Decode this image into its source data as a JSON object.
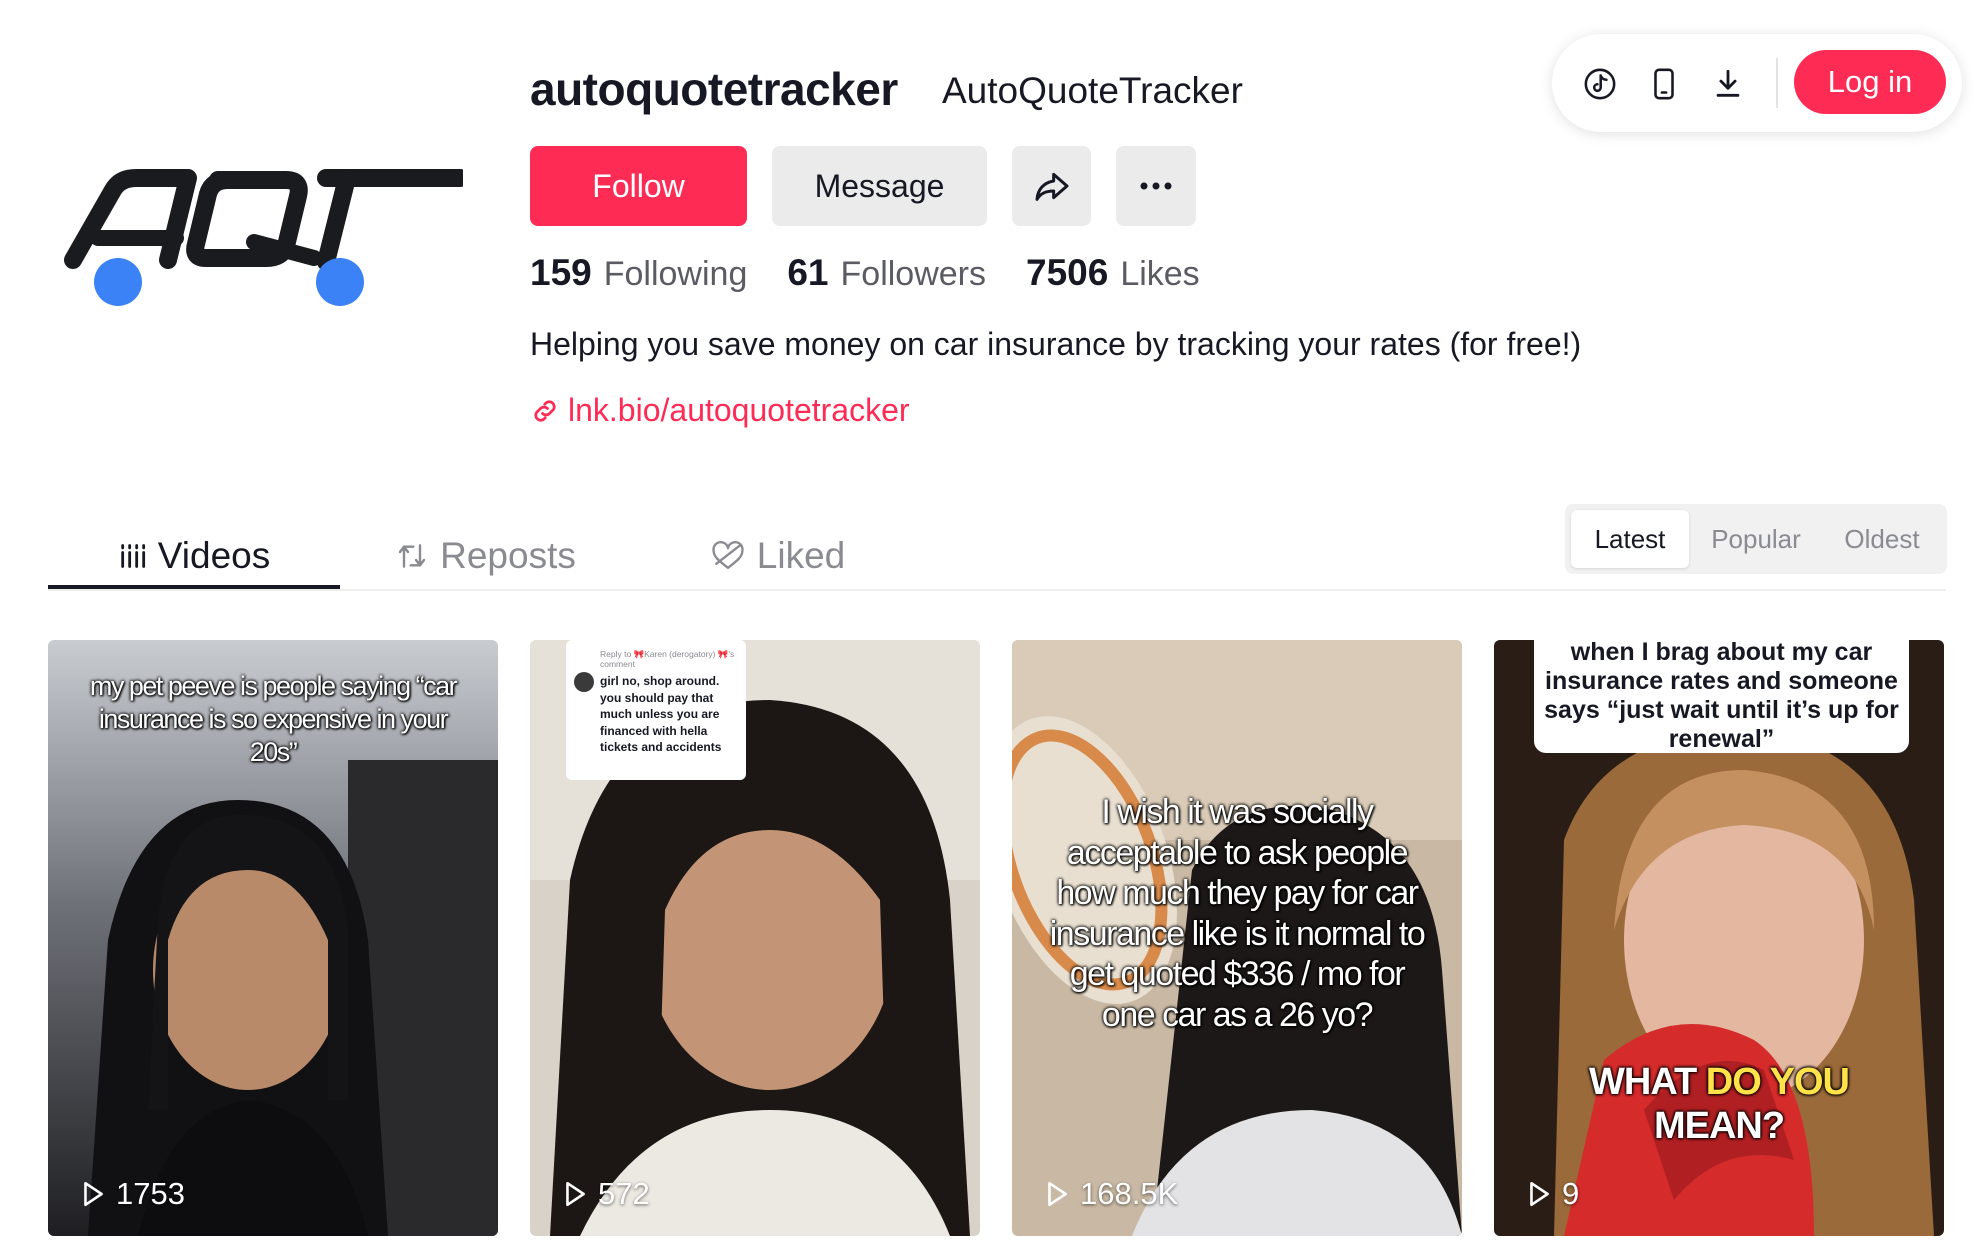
{
  "profile": {
    "username": "autoquotetracker",
    "nickname": "AutoQuoteTracker",
    "follow_label": "Follow",
    "message_label": "Message",
    "bio": "Helping you save money on car insurance by tracking your rates (for free!)",
    "link": "lnk.bio/autoquotetracker",
    "avatar_text": "AQT",
    "stats": [
      {
        "value": "159",
        "label": "Following"
      },
      {
        "value": "61",
        "label": "Followers"
      },
      {
        "value": "7506",
        "label": "Likes"
      }
    ],
    "icons": {
      "share": "share-icon",
      "more": "more-icon",
      "link": "link-icon"
    }
  },
  "topbar": {
    "login_label": "Log in",
    "icons": [
      "tiktok-icon",
      "mobile-icon",
      "download-icon"
    ]
  },
  "tabs": [
    {
      "label": "Videos",
      "icon": "grid-icon"
    },
    {
      "label": "Reposts",
      "icon": "repost-icon"
    },
    {
      "label": "Liked",
      "icon": "liked-heart-icon"
    }
  ],
  "sort": [
    "Latest",
    "Popular",
    "Oldest"
  ],
  "videos": [
    {
      "caption": "my pet peeve is people saying “car insurance is so expensive in your 20s”",
      "views": "1753"
    },
    {
      "caption": "I wish it was socially acceptable to ask people how much they pay for car insurance like is it normal to get quoted $336 / mo for one car as a 26 yo?",
      "views": "168.5K"
    },
    {
      "caption": "when I brag about my car insurance rates and someone says “just wait until it’s up for renewal”",
      "views": "9"
    }
  ],
  "video2": {
    "reply_header": "Reply to 🎀Karen (derogatory) 🎀's comment",
    "reply_text": "girl no, shop around. you should pay that much unless you are financed with hella tickets and accidents",
    "views": "572"
  },
  "video4_subtitle": {
    "line1_white": "WHAT",
    "line1_yellow": "DO YOU",
    "line2": "MEAN?"
  },
  "colors": {
    "accent": "#fe2c55",
    "avatar_wheels": "#3b82f6",
    "text": "#161823",
    "muted": "#8a8b91"
  }
}
